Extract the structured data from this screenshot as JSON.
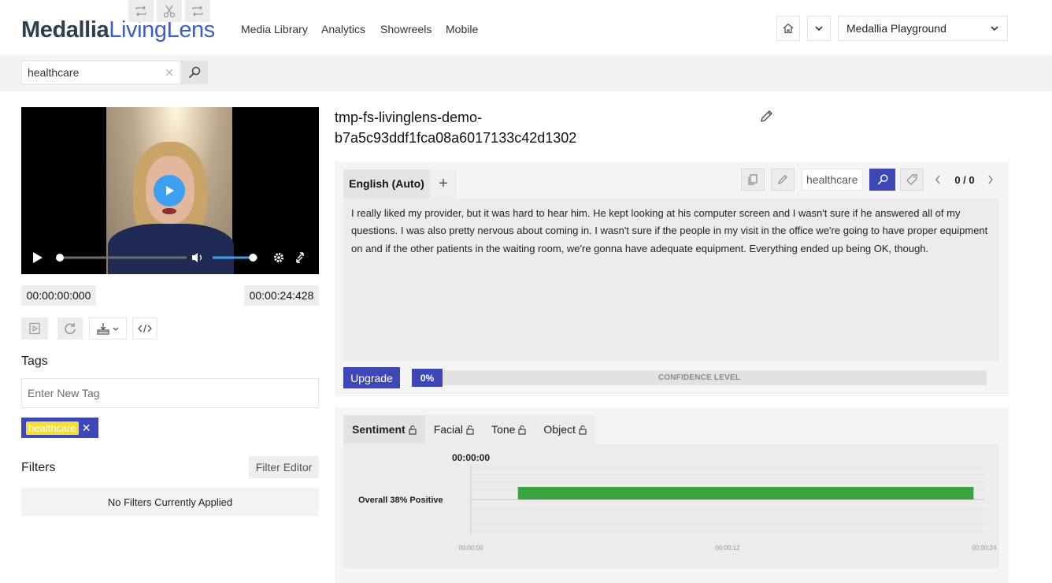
{
  "brand": {
    "part1": "Medallia",
    "part2": "LivingLens"
  },
  "nav": [
    "Media Library",
    "Analytics",
    "Showreels",
    "Mobile"
  ],
  "header": {
    "home_icon": "home-icon",
    "workspace": "Medallia Playground"
  },
  "search": {
    "value": "healthcare"
  },
  "player": {
    "start_time": "00:00:00:000",
    "end_time": "00:00:24:428",
    "progress_fraction": 0.0,
    "volume_fraction": 0.9
  },
  "tags": {
    "title": "Tags",
    "placeholder": "Enter New Tag",
    "items": [
      "healthcare"
    ]
  },
  "filters": {
    "title": "Filters",
    "editor_button": "Filter Editor",
    "empty_text": "No Filters Currently Applied"
  },
  "media": {
    "title_line1": "tmp-fs-livinglens-demo-",
    "title_line2": "b7a5c93ddf1fca08a6017133c42d1302"
  },
  "transcript": {
    "language_tab": "English (Auto)",
    "search_value": "healthcare",
    "match_counter": "0 / 0",
    "text": "I really liked my provider, but it was hard to hear him. He kept looking at his computer screen and I wasn't sure if he answered all of my questions. I was also pretty nervous about coming in. I wasn't sure if the people in my visit in the office we're going to have proper equipment on and if the other patients in the waiting room, we're gonna have adequate equipment. Everything ended up being OK, though.",
    "upgrade_label": "Upgrade",
    "confidence_pct": "0%",
    "confidence_label": "CONFIDENCE LEVEL"
  },
  "analysis": {
    "tabs": [
      "Sentiment",
      "Facial",
      "Tone",
      "Object"
    ],
    "active_tab": "Sentiment"
  },
  "chart_data": {
    "type": "bar",
    "title": "00:00:00",
    "categories": [
      "Overall 38% Positive"
    ],
    "series": [
      {
        "start": 2.2,
        "end": 23.5
      }
    ],
    "x_ticks": [
      "00:00:00",
      "00:00:12",
      "00:00:24"
    ],
    "xlim": [
      0,
      24
    ],
    "bar_color": "#3ca341",
    "grid": true
  }
}
